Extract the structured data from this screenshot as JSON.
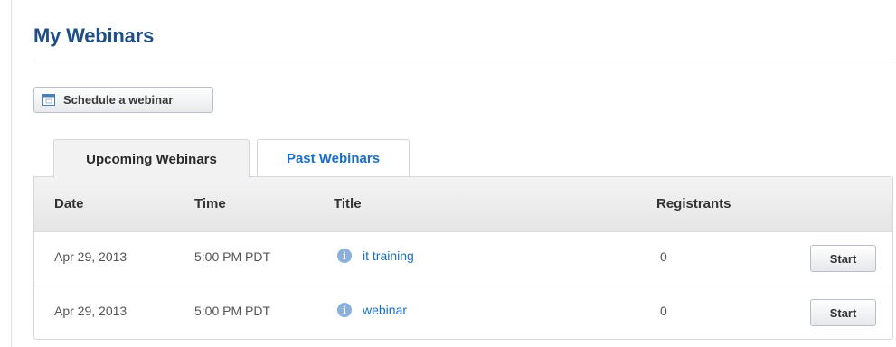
{
  "page": {
    "title": "My Webinars"
  },
  "toolbar": {
    "schedule_label": "Schedule a webinar"
  },
  "tabs": [
    {
      "label": "Upcoming Webinars",
      "active": true
    },
    {
      "label": "Past Webinars",
      "active": false
    }
  ],
  "table": {
    "headers": {
      "date": "Date",
      "time": "Time",
      "title": "Title",
      "registrants": "Registrants"
    },
    "rows": [
      {
        "date": "Apr 29, 2013",
        "time": "5:00 PM PDT",
        "title": "it training",
        "registrants": "0",
        "action": "Start"
      },
      {
        "date": "Apr 29, 2013",
        "time": "5:00 PM PDT",
        "title": "webinar",
        "registrants": "0",
        "action": "Start"
      }
    ]
  },
  "colors": {
    "title": "#1f4f85",
    "link": "#1a6fc4",
    "info_icon": "#8ab0db"
  },
  "icons": {
    "schedule": "calendar-icon",
    "row_info": "info-icon"
  }
}
